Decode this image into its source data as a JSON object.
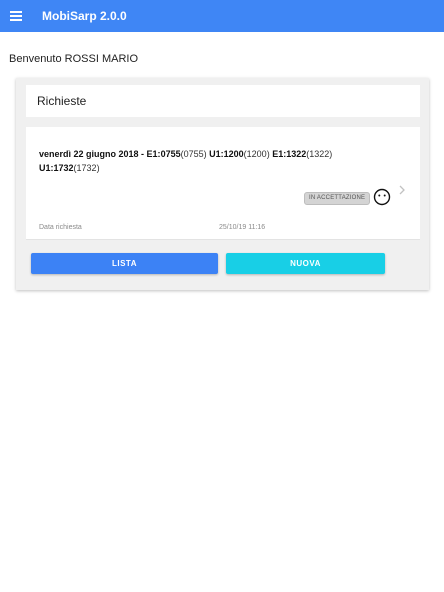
{
  "appbar": {
    "title": "MobiSarp 2.0.0",
    "menu_icon": "hamburger-menu-icon",
    "color": "#3f86f5"
  },
  "welcome": "Benvenuto ROSSI MARIO",
  "requests": {
    "header": "Richieste",
    "items": [
      {
        "date": "venerdì 22 giugno 2018",
        "sep1": " - ",
        "e1a_label": "E1:",
        "e1a_value": "0755",
        "e1a_paren": "(0755)",
        "u1a_label": "U1:",
        "u1a_value": "1200",
        "u1a_paren": "(1200)",
        "e1b_label": "E1:",
        "e1b_value": "1322",
        "e1b_paren": "(1322)",
        "u1b_label": "U1:",
        "u1b_value": "1732",
        "u1b_paren": "(1732)",
        "status": "IN ACCETTAZIONE",
        "status_icon": "neutral-face-icon",
        "meta_label": "Data richiesta",
        "meta_value": "25/10/19 11:16"
      }
    ]
  },
  "buttons": {
    "lista": "LISTA",
    "nuova": "NUOVA",
    "lista_color": "#3c82f5",
    "nuova_color": "#18cfe6"
  }
}
